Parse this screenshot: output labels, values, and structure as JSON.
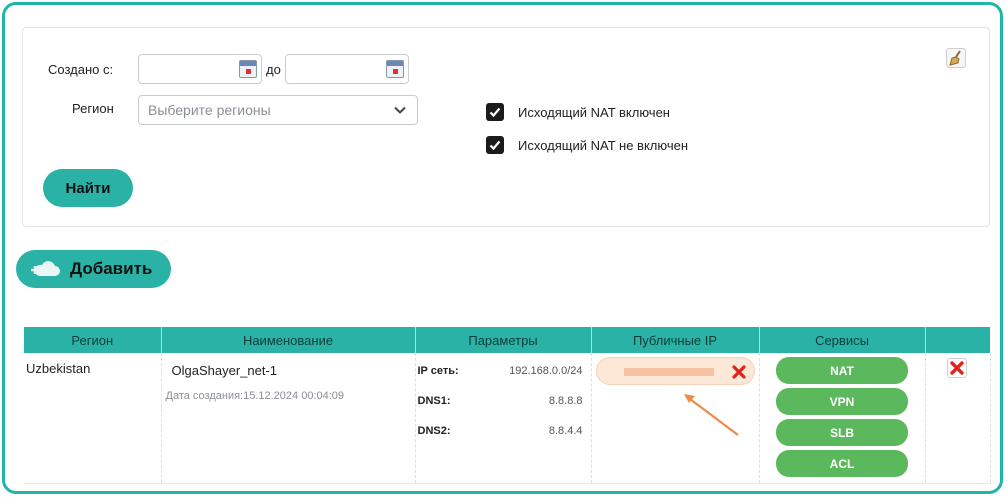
{
  "filters": {
    "created_from_label": "Создано с:",
    "to_label": "до",
    "created_from_value": "",
    "created_to_value": "",
    "region_label": "Регион",
    "region_placeholder": "Выберите регионы",
    "nat_enabled_label": "Исходящий NAT включен",
    "nat_enabled_checked": true,
    "nat_disabled_label": "Исходящий NAT не включен",
    "nat_disabled_checked": true,
    "find_label": "Найти"
  },
  "actions": {
    "add_label": "Добавить"
  },
  "table": {
    "headers": [
      "Регион",
      "Наименование",
      "Параметры",
      "Публичные IP",
      "Сервисы",
      ""
    ],
    "rows": [
      {
        "region": "Uzbekistan",
        "name": "OlgaShayer_net-1",
        "created": "Дата создания:15.12.2024 00:04:09",
        "params": [
          {
            "key": "IP сеть:",
            "value": "192.168.0.0/24"
          },
          {
            "key": "DNS1:",
            "value": "8.8.8.8"
          },
          {
            "key": "DNS2:",
            "value": "8.8.4.4"
          }
        ],
        "services": [
          "NAT",
          "VPN",
          "SLB",
          "ACL"
        ]
      }
    ]
  },
  "colors": {
    "frame": "#1fb5a9",
    "accent": "#2bb2a6",
    "service": "#5cb85c",
    "delete": "#e0241b",
    "annotation": "#f08a4b"
  }
}
